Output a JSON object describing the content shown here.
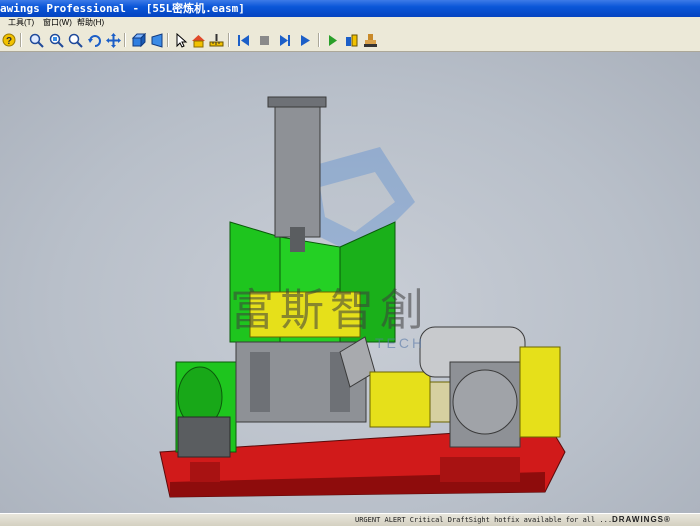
{
  "window": {
    "title": "awings Professional - [55L密炼机.easm]"
  },
  "menu": {
    "items": [
      "工具(T)",
      "窗口(W)",
      "帮助(H)"
    ]
  },
  "toolbar": {
    "icons": [
      "help-icon",
      "zoom-in-out-icon",
      "zoom-to-fit-icon",
      "zoom-to-area-icon",
      "rotate-icon",
      "pan-icon",
      "shaded-view-icon",
      "perspective-icon",
      "select-icon",
      "home-view-icon",
      "measure-icon",
      "go-to-start-icon",
      "stop-icon",
      "play-icon",
      "go-to-end-icon",
      "animation-icon",
      "explode-icon",
      "stamp-icon"
    ]
  },
  "viewport": {
    "watermark_text": "富斯智創",
    "watermark_sub": "TECH",
    "model_name": "55L密炼机"
  },
  "taskbar": {
    "alert": "URGENT ALERT  Critical DraftSight hotfix available for all ...",
    "brand": "DRAWINGS®"
  },
  "colors": {
    "model_green": "#1ec51e",
    "model_yellow": "#e6e01a",
    "model_red": "#d11a1a",
    "model_grey": "#8e9196",
    "titlebar": "#0a56d8"
  }
}
